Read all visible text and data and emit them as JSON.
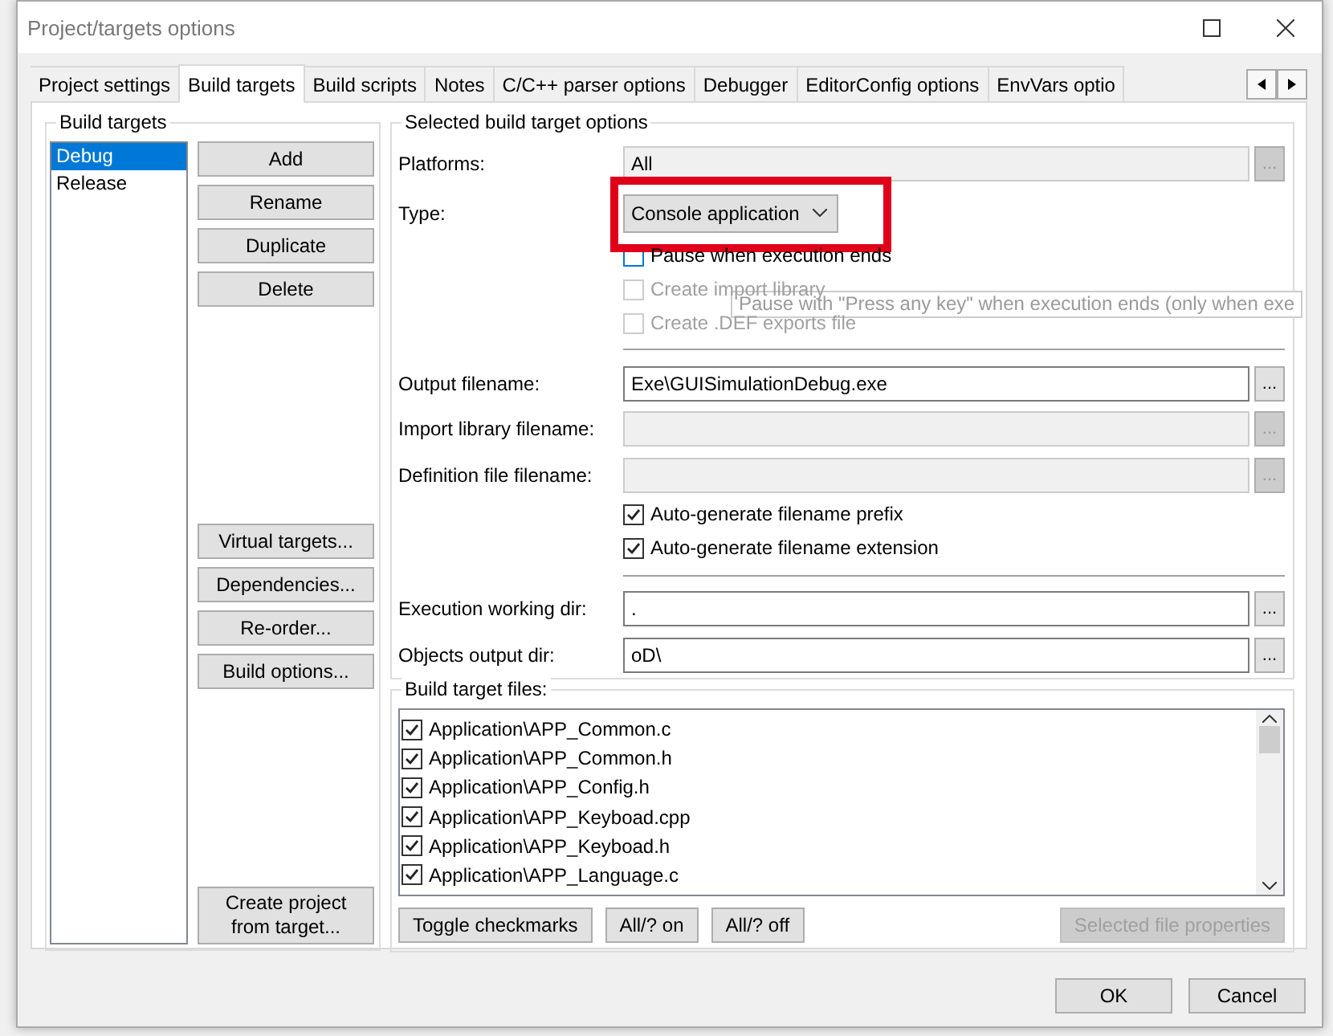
{
  "window": {
    "title": "Project/targets options"
  },
  "tabs": [
    {
      "label": "Project settings",
      "selected": false
    },
    {
      "label": "Build targets",
      "selected": true
    },
    {
      "label": "Build scripts",
      "selected": false
    },
    {
      "label": "Notes",
      "selected": false
    },
    {
      "label": "C/C++ parser options",
      "selected": false
    },
    {
      "label": "Debugger",
      "selected": false
    },
    {
      "label": "EditorConfig options",
      "selected": false
    },
    {
      "label": "EnvVars optio",
      "selected": false
    }
  ],
  "build_targets": {
    "title": "Build targets",
    "items": [
      {
        "label": "Debug",
        "selected": true
      },
      {
        "label": "Release",
        "selected": false
      }
    ],
    "top_buttons": [
      "Add",
      "Rename",
      "Duplicate",
      "Delete"
    ],
    "middle_buttons": [
      "Virtual targets...",
      "Dependencies...",
      "Re-order...",
      "Build options..."
    ],
    "bottom_button": "Create project from target..."
  },
  "options": {
    "title": "Selected build target options",
    "rows": [
      {
        "kind": "field",
        "label": "Platforms:",
        "value": "All",
        "disabled": true,
        "browse": "..."
      },
      {
        "kind": "select",
        "label": "Type:",
        "value": "Console application"
      },
      {
        "kind": "checkbox",
        "label": "Pause when execution ends",
        "checked": false,
        "disabled": false
      },
      {
        "kind": "checkbox",
        "label": "Create import library",
        "checked": false,
        "disabled": true
      },
      {
        "kind": "checkbox",
        "label": "Create .DEF exports file",
        "checked": false,
        "disabled": true
      },
      {
        "kind": "separator"
      },
      {
        "kind": "field",
        "label": "Output filename:",
        "value": "Exe\\GUISimulationDebug.exe",
        "disabled": false,
        "browse": "..."
      },
      {
        "kind": "field",
        "label": "Import library filename:",
        "value": "",
        "disabled": true,
        "browse": "..."
      },
      {
        "kind": "field",
        "label": "Definition file filename:",
        "value": "",
        "disabled": true,
        "browse": "..."
      },
      {
        "kind": "checkbox",
        "label": "Auto-generate filename prefix",
        "checked": true,
        "disabled": false
      },
      {
        "kind": "checkbox",
        "label": "Auto-generate filename extension",
        "checked": true,
        "disabled": false
      },
      {
        "kind": "separator"
      },
      {
        "kind": "field",
        "label": "Execution working dir:",
        "value": ".",
        "disabled": false,
        "browse": "..."
      },
      {
        "kind": "field",
        "label": "Objects output dir:",
        "value": "oD\\",
        "disabled": false,
        "browse": "..."
      }
    ]
  },
  "files": {
    "title": "Build target files:",
    "items": [
      {
        "label": "Application\\APP_Common.c",
        "checked": true
      },
      {
        "label": "Application\\APP_Common.h",
        "checked": true
      },
      {
        "label": "Application\\APP_Config.h",
        "checked": true
      },
      {
        "label": "Application\\APP_Keyboad.cpp",
        "checked": true
      },
      {
        "label": "Application\\APP_Keyboad.h",
        "checked": true
      },
      {
        "label": "Application\\APP_Language.c",
        "checked": true
      }
    ],
    "buttons": [
      {
        "label": "Toggle checkmarks",
        "disabled": false
      },
      {
        "label": "All/? on",
        "disabled": false
      },
      {
        "label": "All/? off",
        "disabled": false
      },
      {
        "label": "Selected file properties",
        "disabled": true
      }
    ]
  },
  "tooltip": "Pause with \"Press any key\" when execution ends (only when exe",
  "dialog_buttons": [
    "OK",
    "Cancel"
  ]
}
